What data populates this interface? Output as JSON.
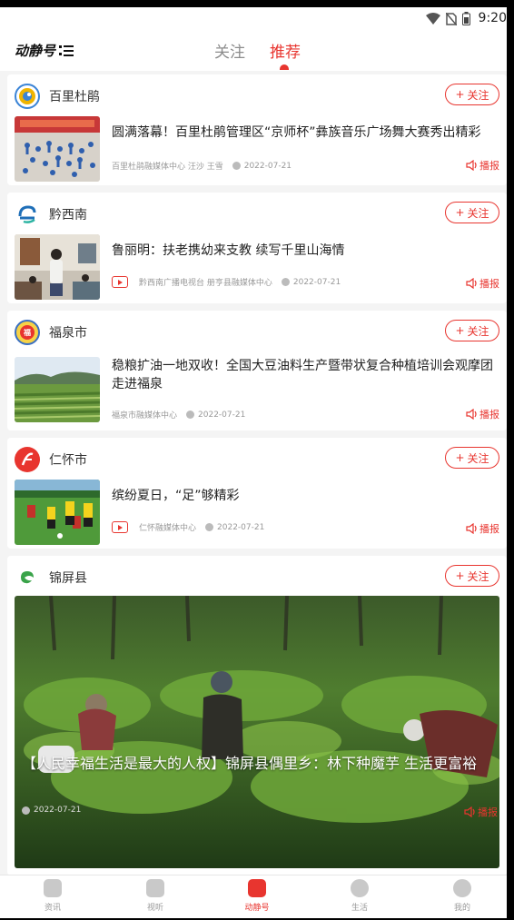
{
  "status_bar": {
    "time": "9:20"
  },
  "header": {
    "logo": "动静号",
    "tabs": [
      {
        "label": "关注"
      },
      {
        "label": "推荐"
      }
    ]
  },
  "cards": [
    {
      "account": "百里杜鹃",
      "follow_label": "关注",
      "title": "圆满落幕！百里杜鹃管理区“京师杯”彝族音乐广场舞大赛秀出精彩",
      "source": "百里杜鹃融媒体中心 汪沙 王雪",
      "date": "2022-07-21",
      "play_label": "播报"
    },
    {
      "account": "黔西南",
      "follow_label": "关注",
      "title": "鲁丽明：扶老携幼来支教 续写千里山海情",
      "source": "黔西南广播电视台 册亨县融媒体中心",
      "date": "2022-07-21",
      "play_label": "播报"
    },
    {
      "account": "福泉市",
      "follow_label": "关注",
      "title": "稳粮扩油一地双收！全国大豆油料生产暨带状复合种植培训会观摩团走进福泉",
      "source": "福泉市融媒体中心",
      "date": "2022-07-21",
      "play_label": "播报"
    },
    {
      "account": "仁怀市",
      "follow_label": "关注",
      "title": "缤纷夏日，“足”够精彩",
      "source": "仁怀融媒体中心",
      "date": "2022-07-21",
      "play_label": "播报"
    },
    {
      "account": "锦屏县",
      "follow_label": "关注",
      "title": "【人民幸福生活是最大的人权】锦屏县偶里乡：林下种魔芋 生活更富裕",
      "date": "2022-07-21",
      "play_label": "播报"
    }
  ],
  "tabbar": [
    {
      "label": "资讯"
    },
    {
      "label": "视听"
    },
    {
      "label": "动静号"
    },
    {
      "label": "生活"
    },
    {
      "label": "我的"
    }
  ],
  "colors": {
    "accent": "#e8352f",
    "background": "#f4f4f4"
  }
}
